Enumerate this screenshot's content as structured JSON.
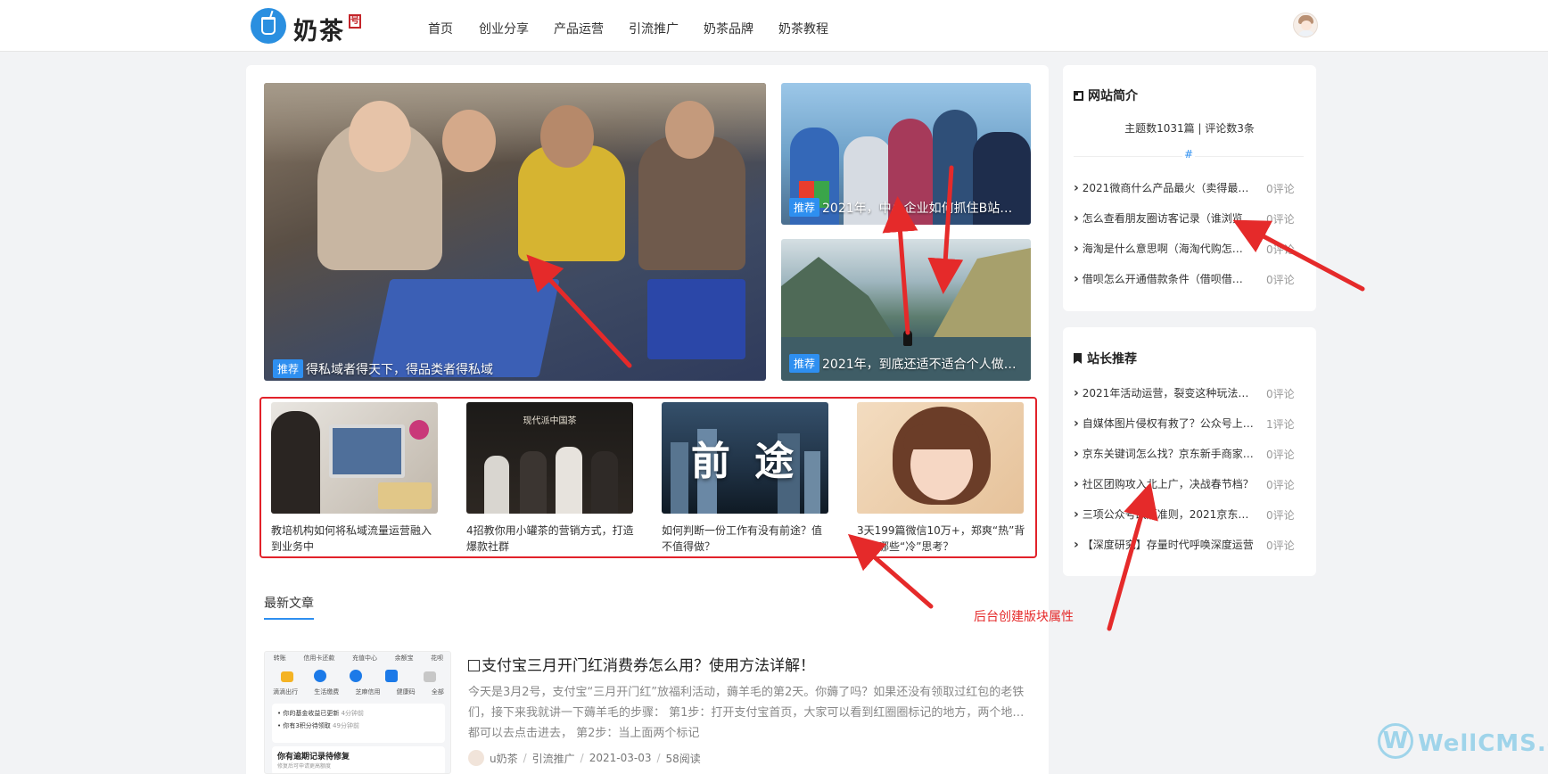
{
  "header": {
    "logo_text": "奶茶",
    "logo_seal": "号",
    "nav": [
      "首页",
      "创业分享",
      "产品运营",
      "引流推广",
      "奶茶品牌",
      "奶茶教程"
    ]
  },
  "hero": {
    "main": {
      "tag": "推荐",
      "caption": "得私域者得天下，得品类者得私域"
    },
    "side": [
      {
        "tag": "推荐",
        "caption": "2021年，中小企业如何抓住B站…"
      },
      {
        "tag": "推荐",
        "caption": "2021年，到底还适不适合个人做…"
      }
    ]
  },
  "featured": [
    {
      "title": "教培机构如何将私域流量运营融入到业务中"
    },
    {
      "title": "4招教你用小罐茶的营销方式，打造爆款社群",
      "thumb_text": "现代派中国茶"
    },
    {
      "title": "如何判断一份工作有没有前途？值不值得做？",
      "thumb_text": "前 途"
    },
    {
      "title": "3天199篇微信10万+，郑爽“热”背后有哪些“冷”思考？"
    }
  ],
  "latest": {
    "tab": "最新文章",
    "article": {
      "title": "支付宝三月开门红消费券怎么用？使用方法详解！",
      "excerpt": "今天是3月2号，支付宝“三月开门红”放福利活动，薅羊毛的第2天。你薅了吗？如果还没有领取过红包的老铁们，接下来我就讲一下薅羊毛的步骤： 第1步：打开支付宝首页，大家可以看到红圈圈标记的地方，两个地…都可以去点击进去， 第2步：当上面两个标记",
      "author": "u奶茶",
      "category": "引流推广",
      "date": "2021-03-03",
      "views": "58阅读"
    },
    "thumb_icons": [
      "转账",
      "信用卡还款",
      "充值中心",
      "余额宝",
      "花呗",
      "滴滴出行",
      "生活缴费",
      "芝麻信用",
      "健康码",
      "全部"
    ],
    "thumb_lines": [
      "• 你的基金收益已更新",
      "• 你有3积分待领取",
      "4分钟前",
      "49分钟前",
      "你有逾期记录待修复",
      "修复后可申请更高额度"
    ]
  },
  "sidebar": {
    "intro": {
      "title": "网站简介",
      "stats": "主题数1031篇 | 评论数3条",
      "hash": "#",
      "items": [
        {
          "title": "2021微商什么产品最火（卖得最火的…",
          "comments": "0评论"
        },
        {
          "title": "怎么查看朋友圈访客记录（谁浏览…",
          "comments": "0评论"
        },
        {
          "title": "海淘是什么意思啊（海淘代购怎…",
          "comments": "0评论"
        },
        {
          "title": "借呗怎么开通借款条件（借呗借…",
          "comments": "0评论"
        }
      ]
    },
    "recommend": {
      "title": "站长推荐",
      "items": [
        {
          "title": "2021年活动运营，裂变这种玩法还…",
          "comments": "0评论"
        },
        {
          "title": "自媒体图片侵权有救了？公众号上…",
          "comments": "1评论"
        },
        {
          "title": "京东关键词怎么找？京东新手商家…",
          "comments": "0评论"
        },
        {
          "title": "社区团购攻入北上广，决战春节档？",
          "comments": "0评论"
        },
        {
          "title": "三项公众号改版准则，2021京东春…",
          "comments": "0评论"
        },
        {
          "title": "【深度研究】存量时代呼唤深度运营",
          "comments": "0评论"
        }
      ]
    }
  },
  "annotation": {
    "text": "后台创建版块属性",
    "color": "#e52a2a"
  },
  "watermark": {
    "text": "WellCMS.cn",
    "logo_letter": "W"
  }
}
